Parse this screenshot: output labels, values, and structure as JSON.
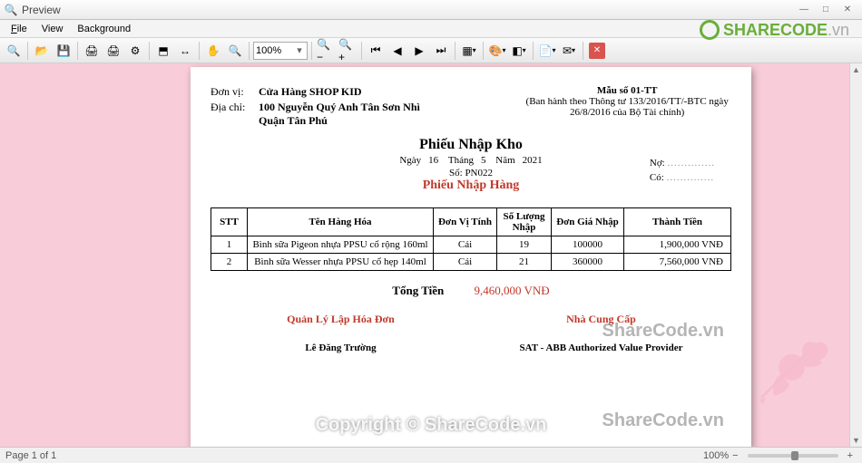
{
  "window": {
    "title": "Preview"
  },
  "menu": {
    "file": "File",
    "view": "View",
    "background": "Background"
  },
  "toolbar": {
    "zoom_value": "100%"
  },
  "logo": {
    "text": "SHARECODE",
    "suffix": ".vn"
  },
  "doc": {
    "donvi_lbl": "Đơn vị:",
    "donvi": "Cửa Hàng SHOP KID",
    "diachi_lbl": "Địa chỉ:",
    "diachi_l1": "100 Nguyễn Quý Anh Tân Sơn Nhì",
    "diachi_l2": "Quận Tân Phú",
    "mau_so": "Mẫu số 01-TT",
    "banhanh_l1": "(Ban hành theo Thông tư 133/2016/TT/-BTC ngày",
    "banhanh_l2": "26/8/2016 của Bộ Tài chính)",
    "title": "Phiếu Nhập Kho",
    "ngay_lbl": "Ngày",
    "ngay": "16",
    "thang_lbl": "Tháng",
    "thang": "5",
    "nam_lbl": "Năm",
    "nam": "2021",
    "so_lbl": "Số:",
    "so": "PN022",
    "no_lbl": "Nợ:",
    "co_lbl": "Có:",
    "dots": "..............",
    "red_title": "Phiếu Nhập Hàng",
    "headers": {
      "stt": "STT",
      "ten": "Tên Hàng Hóa",
      "dvt": "Đơn Vị Tính",
      "sl": "Số Lượng Nhập",
      "dg": "Đơn Giá Nhập",
      "tt": "Thành Tiền"
    },
    "rows": [
      {
        "stt": "1",
        "ten": "Bình sữa Pigeon nhựa PPSU cổ rộng 160ml",
        "dvt": "Cái",
        "sl": "19",
        "dg": "100000",
        "tt": "1,900,000 VNĐ"
      },
      {
        "stt": "2",
        "ten": "Bình sữa Wesser nhựa PPSU cổ hẹp 140ml",
        "dvt": "Cái",
        "sl": "21",
        "dg": "360000",
        "tt": "7,560,000 VNĐ"
      }
    ],
    "tong_lbl": "Tổng Tiền",
    "tong": "9,460,000 VNĐ",
    "ql_lbl": "Quản Lý Lập Hóa Đơn",
    "ql_name": "Lê Đăng Trường",
    "ncc_lbl": "Nhà Cung Cấp",
    "ncc_name": "SAT - ABB Authorized Value Provider"
  },
  "watermarks": {
    "sc": "ShareCode.vn",
    "cp": "Copyright © ShareCode.vn"
  },
  "status": {
    "page": "Page 1 of 1",
    "zoom": "100%"
  }
}
